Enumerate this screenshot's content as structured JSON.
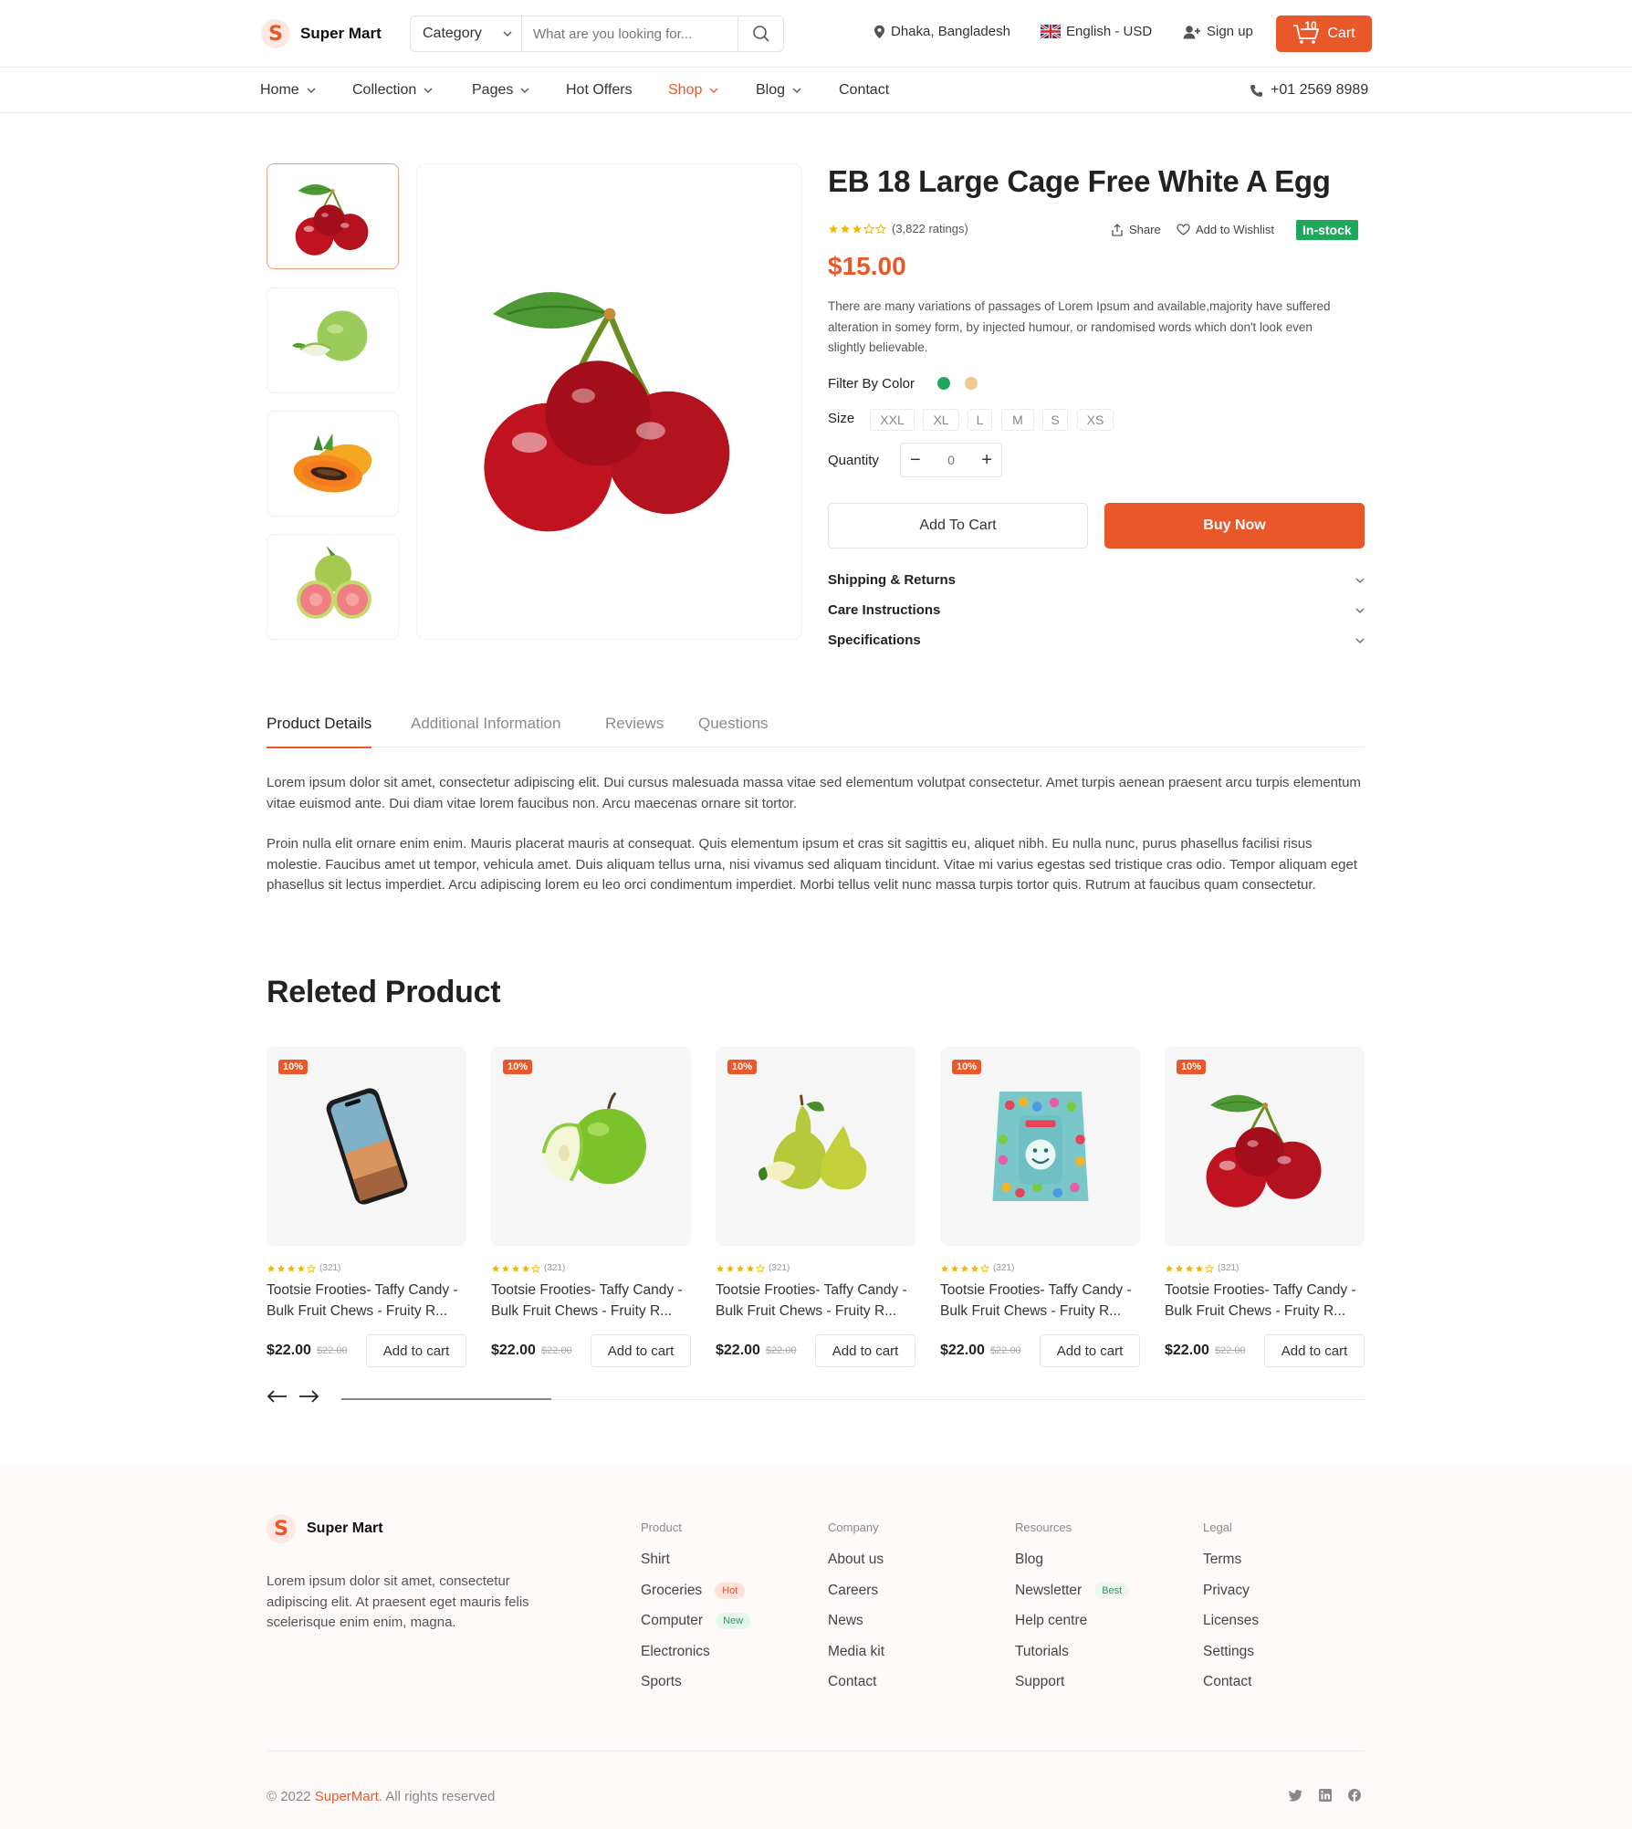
{
  "header": {
    "brand": "Super Mart",
    "search": {
      "category": "Category",
      "placeholder": "What are you looking for..."
    },
    "location": "Dhaka, Bangladesh",
    "language": "English - USD",
    "signup": "Sign up",
    "cart_label": "Cart",
    "cart_count": "10"
  },
  "nav": {
    "items": [
      {
        "label": "Home",
        "dropdown": true
      },
      {
        "label": "Collection",
        "dropdown": true
      },
      {
        "label": "Pages",
        "dropdown": true
      },
      {
        "label": "Hot Offers",
        "dropdown": false
      },
      {
        "label": "Shop",
        "dropdown": true,
        "active": true
      },
      {
        "label": "Blog",
        "dropdown": true
      },
      {
        "label": "Contact",
        "dropdown": false
      }
    ],
    "phone": "+01 2569 8989"
  },
  "product": {
    "thumbnails": [
      "cherries",
      "guava",
      "papaya",
      "red guava"
    ],
    "title": "EB 18 Large Cage Free White A Egg",
    "rating": 3,
    "ratings_text": "(3,822 ratings)",
    "share": "Share",
    "wishlist": "Add to Wishlist",
    "stock": "In-stock",
    "price": "$15.00",
    "description": "There are many variations of passages of Lorem Ipsum and available,majority have suffered alteration in somey form, by injected humour, or randomised words which don't look even slightly believable.",
    "color_label": "Filter By Color",
    "colors": [
      "#1fa85d",
      "#f0c98f"
    ],
    "size_label": "Size",
    "sizes": [
      "XXL",
      "XL",
      "L",
      "M",
      "S",
      "XS"
    ],
    "quantity_label": "Quantity",
    "quantity": "0",
    "add_to_cart": "Add To Cart",
    "buy_now": "Buy Now",
    "accordions": [
      "Shipping & Returns",
      "Care Instructions",
      "Specifications"
    ]
  },
  "tabs": {
    "items": [
      "Product Details",
      "Additional Information",
      "Reviews",
      "Questions"
    ],
    "active": "Product Details",
    "paragraphs": [
      "Lorem ipsum dolor sit amet, consectetur adipiscing elit. Dui cursus malesuada massa vitae sed elementum volutpat consectetur. Amet turpis aenean praesent arcu turpis elementum vitae euismod ante. Dui diam vitae lorem faucibus non. Arcu maecenas ornare sit tortor.",
      "Proin nulla elit ornare enim enim. Mauris placerat mauris at consequat. Quis elementum ipsum et cras sit sagittis eu, aliquet nibh. Eu nulla nunc, purus phasellus facilisi risus molestie. Faucibus amet ut tempor, vehicula amet. Duis aliquam tellus urna, nisi vivamus sed aliquam tincidunt. Vitae mi varius egestas sed tristique cras odio. Tempor aliquam eget phasellus sit lectus imperdiet. Arcu adipiscing lorem eu leo orci condimentum imperdiet. Morbi tellus velit nunc massa turpis tortor quis. Rutrum at faucibus quam consectetur."
    ]
  },
  "related": {
    "title": "Releted Product",
    "cards": [
      {
        "image": "phone",
        "badge": "10%",
        "rating": 4,
        "reviews": "(321)",
        "name": "Tootsie Frooties- Taffy Candy - Bulk Fruit Chews - Fruity R...",
        "price": "$22.00",
        "old_price": "$22.00",
        "button": "Add to cart"
      },
      {
        "image": "green apple",
        "badge": "10%",
        "rating": 4,
        "reviews": "(321)",
        "name": "Tootsie Frooties- Taffy Candy - Bulk Fruit Chews - Fruity R...",
        "price": "$22.00",
        "old_price": "$22.00",
        "button": "Add to cart"
      },
      {
        "image": "pears",
        "badge": "10%",
        "rating": 4,
        "reviews": "(321)",
        "name": "Tootsie Frooties- Taffy Candy - Bulk Fruit Chews - Fruity R...",
        "price": "$22.00",
        "old_price": "$22.00",
        "button": "Add to cart"
      },
      {
        "image": "candy bag",
        "badge": "10%",
        "rating": 4,
        "reviews": "(321)",
        "name": "Tootsie Frooties- Taffy Candy - Bulk Fruit Chews - Fruity R...",
        "price": "$22.00",
        "old_price": "$22.00",
        "button": "Add to cart"
      },
      {
        "image": "cherries",
        "badge": "10%",
        "rating": 4,
        "reviews": "(321)",
        "name": "Tootsie Frooties- Taffy Candy - Bulk Fruit Chews - Fruity R...",
        "price": "$22.00",
        "old_price": "$22.00",
        "button": "Add to cart"
      }
    ]
  },
  "footer": {
    "brand": "Super Mart",
    "about": "Lorem ipsum dolor sit amet, consectetur adipiscing elit. At praesent eget mauris felis scelerisque enim enim, magna.",
    "columns": [
      {
        "heading": "Product",
        "links": [
          {
            "label": "Shirt"
          },
          {
            "label": "Groceries",
            "tag": "Hot"
          },
          {
            "label": "Computer",
            "tag": "New"
          },
          {
            "label": "Electronics"
          },
          {
            "label": "Sports"
          }
        ]
      },
      {
        "heading": "Company",
        "links": [
          {
            "label": "About us"
          },
          {
            "label": "Careers"
          },
          {
            "label": "News"
          },
          {
            "label": "Media kit"
          },
          {
            "label": "Contact"
          }
        ]
      },
      {
        "heading": "Resources",
        "links": [
          {
            "label": "Blog"
          },
          {
            "label": "Newsletter",
            "tag": "Best"
          },
          {
            "label": "Help centre"
          },
          {
            "label": "Tutorials"
          },
          {
            "label": "Support"
          }
        ]
      },
      {
        "heading": "Legal",
        "links": [
          {
            "label": "Terms"
          },
          {
            "label": "Privacy"
          },
          {
            "label": "Licenses"
          },
          {
            "label": "Settings"
          },
          {
            "label": "Contact"
          }
        ]
      }
    ],
    "copyright_prefix": "© 2022 ",
    "copyright_brand": "SuperMart",
    "copyright_suffix": ". All rights reserved",
    "social": [
      "twitter-icon",
      "linkedin-icon",
      "facebook-icon"
    ]
  },
  "theme": {
    "accent": "#e9582b",
    "success": "#1fa85d",
    "star": "#f5b800"
  }
}
